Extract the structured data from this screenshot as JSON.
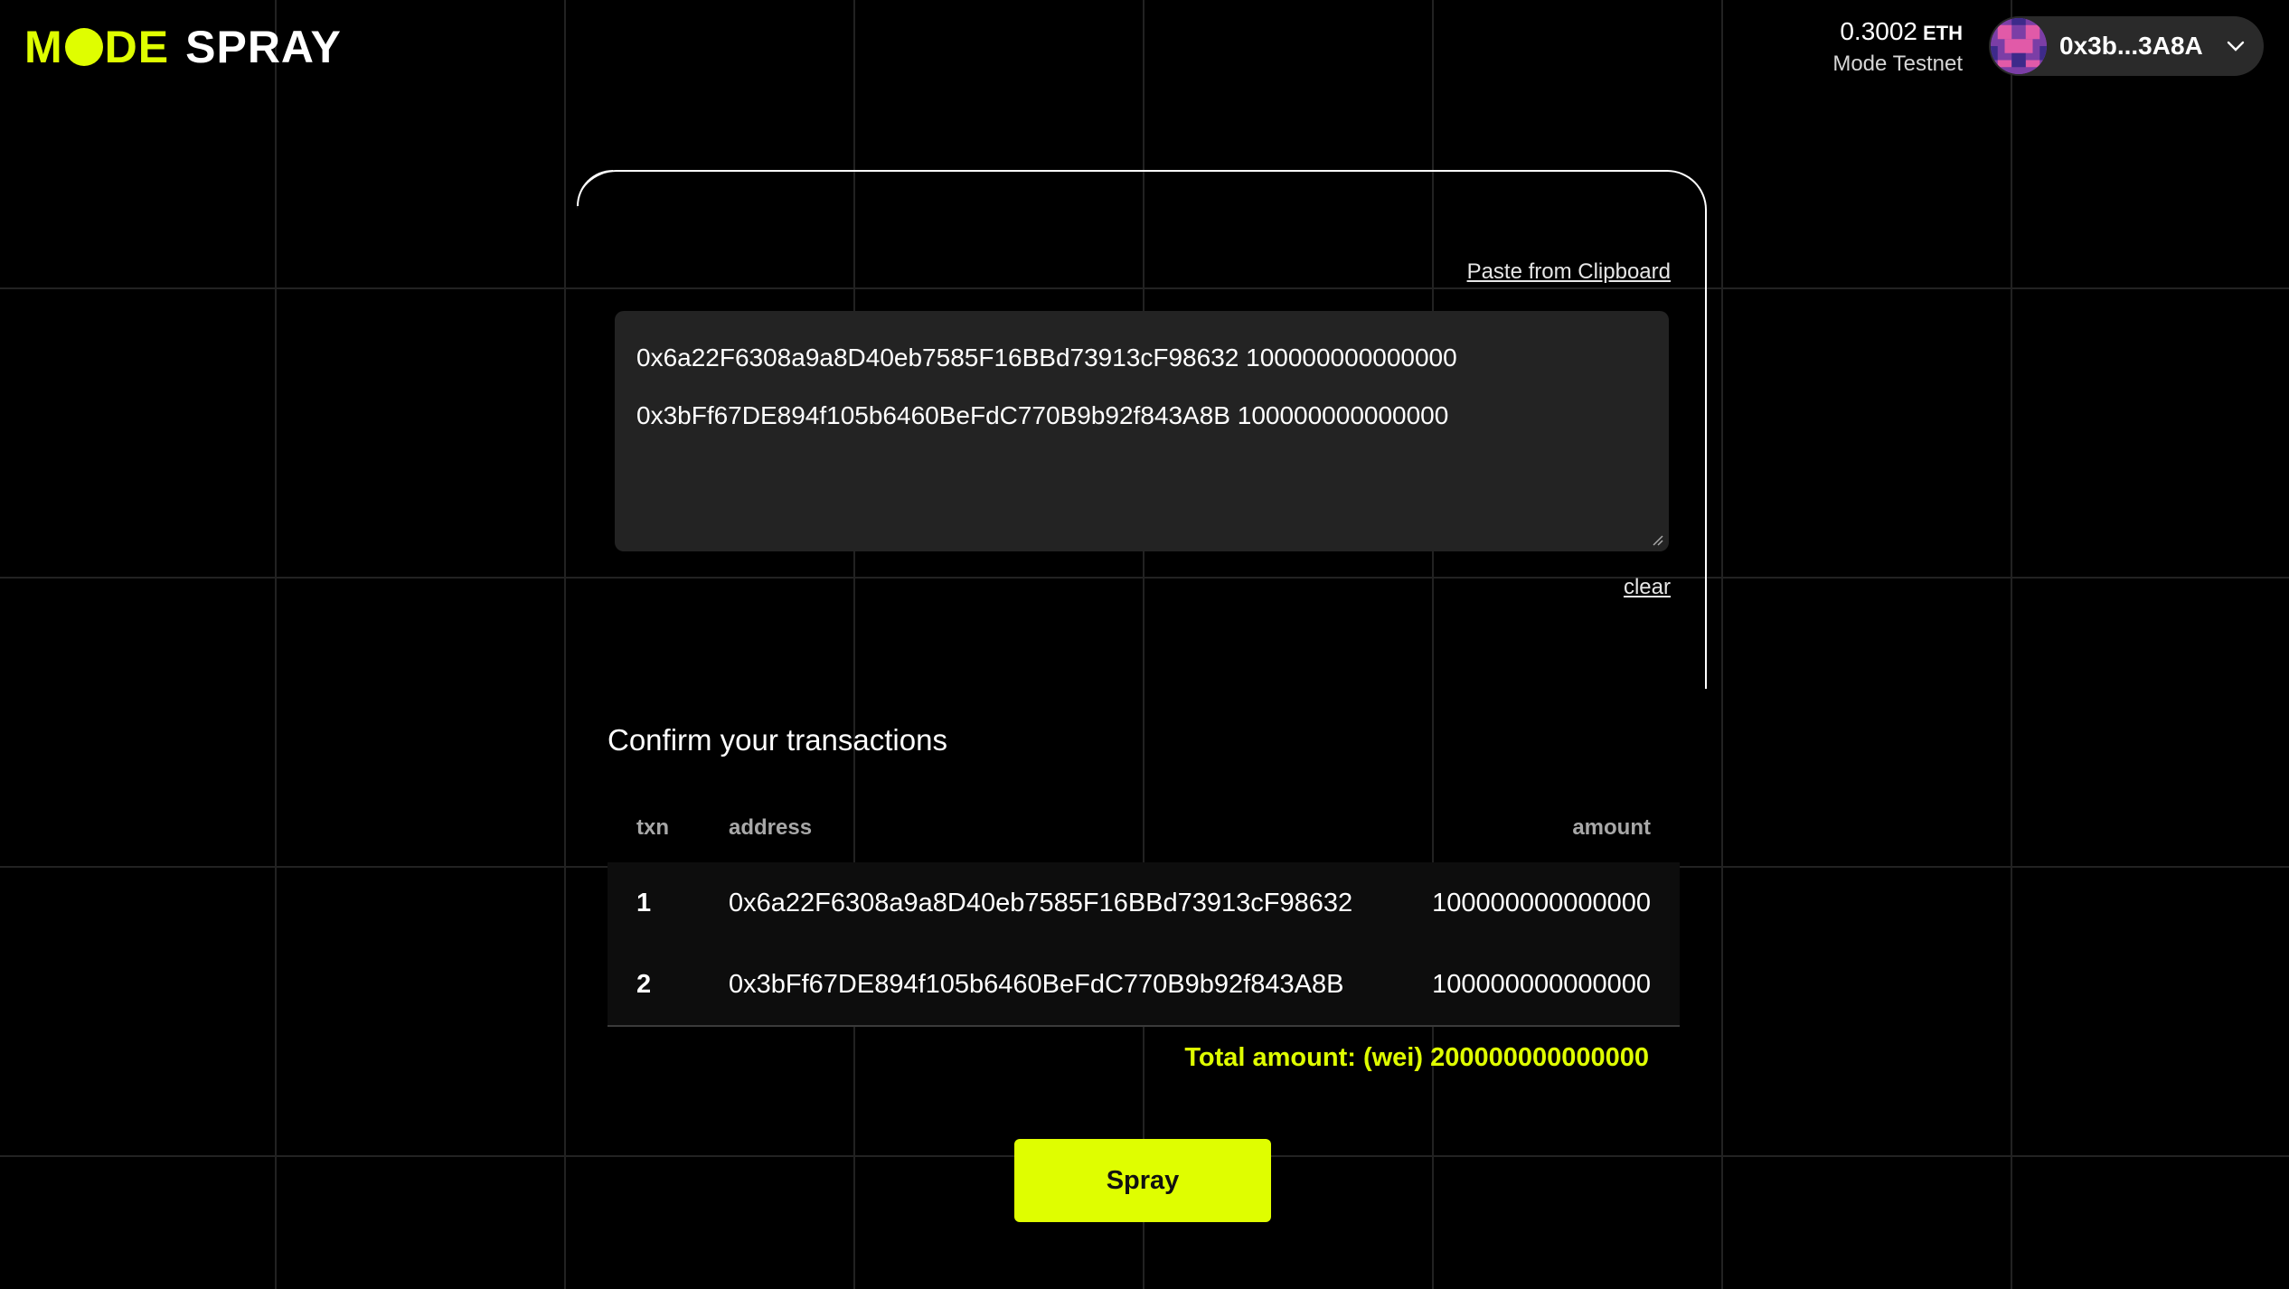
{
  "header": {
    "logo_mode": [
      "M",
      "DE"
    ],
    "logo_spray": "SPRAY",
    "balance_value": "0.3002",
    "balance_unit": "ETH",
    "network": "Mode Testnet",
    "wallet_address": "0x3b...3A8A"
  },
  "input": {
    "paste_label": "Paste from Clipboard",
    "lines": [
      "0x6a22F6308a9a8D40eb7585F16BBd73913cF98632 100000000000000",
      "0x3bFf67DE894f105b6460BeFdC770B9b92f843A8B 100000000000000"
    ],
    "clear_label": "clear"
  },
  "confirm": {
    "title": "Confirm your transactions",
    "columns": {
      "txn": "txn",
      "address": "address",
      "amount": "amount"
    },
    "rows": [
      {
        "txn": "1",
        "address": "0x6a22F6308a9a8D40eb7585F16BBd73913cF98632",
        "amount": "100000000000000"
      },
      {
        "txn": "2",
        "address": "0x3bFf67DE894f105b6460BeFdC770B9b92f843A8B",
        "amount": "100000000000000"
      }
    ],
    "total": "Total amount: (wei) 200000000000000"
  },
  "actions": {
    "spray_label": "Spray"
  },
  "colors": {
    "accent": "#dffe00",
    "background": "#000000",
    "panel": "#232323"
  }
}
